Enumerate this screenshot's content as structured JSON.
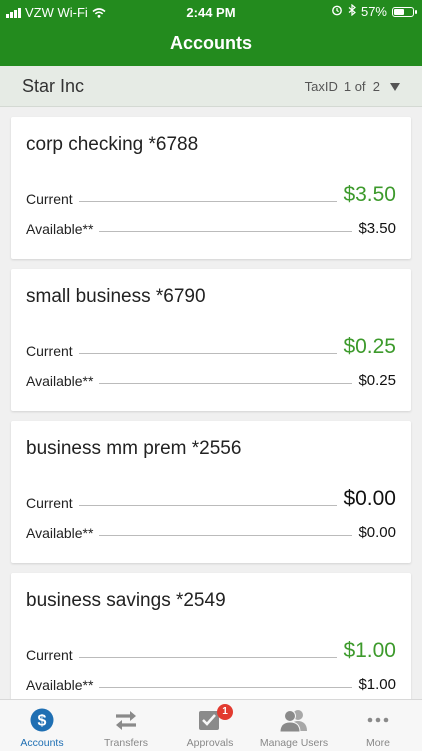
{
  "status_bar": {
    "carrier": "VZW Wi-Fi",
    "time": "2:44 PM",
    "battery": "57%",
    "battery_level": 0.57
  },
  "header": {
    "title": "Accounts"
  },
  "org": {
    "name": "Star Inc",
    "tax_label": "TaxID",
    "page": "1 of  2"
  },
  "accounts": [
    {
      "name": "corp checking *6788",
      "current_label": "Current",
      "current": "$3.50",
      "current_color": "green",
      "available_label": "Available**",
      "available": "$3.50"
    },
    {
      "name": "small business *6790",
      "current_label": "Current",
      "current": "$0.25",
      "current_color": "green",
      "available_label": "Available**",
      "available": "$0.25"
    },
    {
      "name": "business mm prem *2556",
      "current_label": "Current",
      "current": "$0.00",
      "current_color": "black",
      "available_label": "Available**",
      "available": "$0.00"
    },
    {
      "name": "business savings *2549",
      "current_label": "Current",
      "current": "$1.00",
      "current_color": "green",
      "available_label": "Available**",
      "available": "$1.00"
    }
  ],
  "tabs": [
    {
      "label": "Accounts",
      "icon": "dollar-circle-icon",
      "active": true
    },
    {
      "label": "Transfers",
      "icon": "transfer-arrows-icon",
      "active": false
    },
    {
      "label": "Approvals",
      "icon": "checkbox-icon",
      "active": false,
      "badge": "1"
    },
    {
      "label": "Manage Users",
      "icon": "users-icon",
      "active": false
    },
    {
      "label": "More",
      "icon": "more-dots-icon",
      "active": false
    }
  ],
  "colors": {
    "header": "#238b1e",
    "positive": "#3d9a2c",
    "active_tab": "#1f6fb3"
  }
}
